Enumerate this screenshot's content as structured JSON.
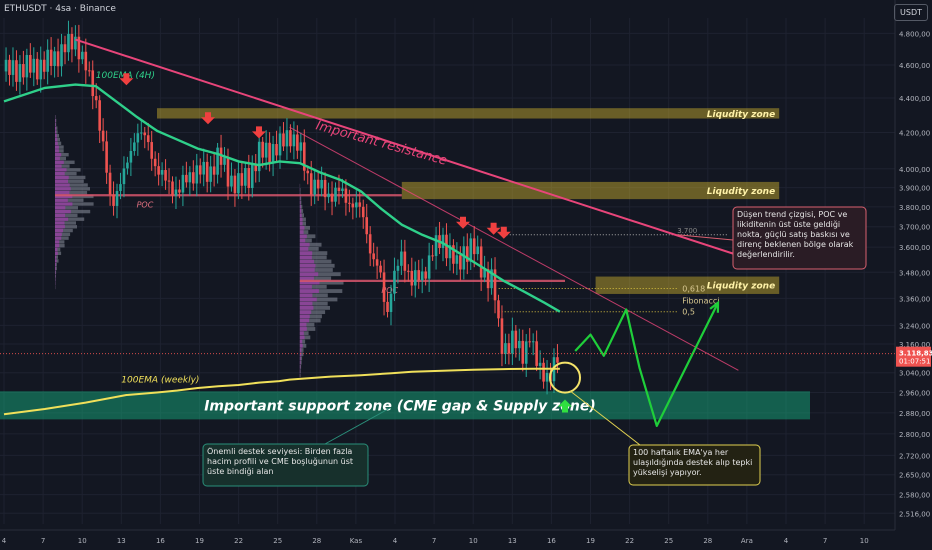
{
  "header": {
    "symbol_line": "ETHUSDT · 4sa · Binance",
    "currency": "USDT"
  },
  "colors": {
    "background": "#131722",
    "bull_candle": "#26a69a",
    "bear_candle": "#ef5350",
    "ema_4h": "#2fd08a",
    "ema_weekly": "#f0e05a",
    "resistance": "#e8457a",
    "liquidity": "#e0c030",
    "support": "#15a87a",
    "forecast": "#1fcf3a"
  },
  "chart_data": {
    "type": "candlestick",
    "x_axis": {
      "labels": [
        "4",
        "7",
        "10",
        "13",
        "16",
        "19",
        "22",
        "25",
        "28",
        "Kas",
        "4",
        "7",
        "10",
        "13",
        "16",
        "19",
        "22",
        "25",
        "28",
        "Ara",
        "4",
        "7",
        "10"
      ]
    },
    "y_axis": {
      "scale": "log",
      "ylim": [
        2480,
        4900
      ],
      "ticks": [
        "4.800,00",
        "4.600,00",
        "4.400,00",
        "4.200,00",
        "4.000,00",
        "3.900,00",
        "3.800,00",
        "3.700,00",
        "3.600,00",
        "3.480,00",
        "3.360,00",
        "3.240,00",
        "3.160,00",
        "3.040,00",
        "2.960,00",
        "2.880,00",
        "2.800,00",
        "2.720,00",
        "2.650,00",
        "2.580,00",
        "2.516,00"
      ]
    },
    "price_label": {
      "value": "3.118,83",
      "countdown": "01:07:51",
      "price": 3118.83
    },
    "price_path": [
      [
        0,
        4560
      ],
      [
        4,
        4600
      ],
      [
        7,
        4760
      ],
      [
        8,
        4580
      ],
      [
        9,
        4400
      ],
      [
        10,
        4000
      ],
      [
        10.5,
        3800
      ],
      [
        11,
        3880
      ],
      [
        12,
        4000
      ],
      [
        13,
        4220
      ],
      [
        14,
        4150
      ],
      [
        15,
        4000
      ],
      [
        16,
        3920
      ],
      [
        17,
        3880
      ],
      [
        18,
        3950
      ],
      [
        19,
        4000
      ],
      [
        20,
        3960
      ],
      [
        21,
        4080
      ],
      [
        22,
        3950
      ],
      [
        23,
        3920
      ],
      [
        24,
        3960
      ],
      [
        25,
        4080
      ],
      [
        26,
        4100
      ],
      [
        27,
        4120
      ],
      [
        28,
        4200
      ],
      [
        29,
        4100
      ],
      [
        30,
        3920
      ],
      [
        31,
        3900
      ],
      [
        32,
        3860
      ],
      [
        33,
        3880
      ],
      [
        34,
        3820
      ],
      [
        35,
        3780
      ],
      [
        35.5,
        3700
      ],
      [
        36,
        3560
      ],
      [
        37,
        3450
      ],
      [
        37.5,
        3280
      ],
      [
        38,
        3420
      ],
      [
        39,
        3560
      ],
      [
        40,
        3440
      ],
      [
        41,
        3460
      ],
      [
        42,
        3580
      ],
      [
        43,
        3640
      ],
      [
        44,
        3550
      ],
      [
        44.5,
        3490
      ],
      [
        45,
        3580
      ],
      [
        46,
        3600
      ],
      [
        47,
        3480
      ],
      [
        48,
        3430
      ],
      [
        48.5,
        3220
      ],
      [
        49,
        3140
      ],
      [
        50,
        3170
      ],
      [
        51,
        3120
      ],
      [
        51.5,
        3200
      ],
      [
        52,
        3100
      ],
      [
        53,
        3040
      ],
      [
        53.5,
        3000
      ],
      [
        54,
        3080
      ],
      [
        54.5,
        3118.83
      ]
    ],
    "ema_4h": [
      [
        0,
        4380
      ],
      [
        4,
        4460
      ],
      [
        7,
        4480
      ],
      [
        9,
        4470
      ],
      [
        11,
        4380
      ],
      [
        13,
        4290
      ],
      [
        15,
        4210
      ],
      [
        17,
        4160
      ],
      [
        19,
        4110
      ],
      [
        21,
        4080
      ],
      [
        23,
        4040
      ],
      [
        25,
        4020
      ],
      [
        27,
        4040
      ],
      [
        29,
        4030
      ],
      [
        31,
        3980
      ],
      [
        33,
        3940
      ],
      [
        35,
        3880
      ],
      [
        37,
        3790
      ],
      [
        39,
        3710
      ],
      [
        41,
        3660
      ],
      [
        43,
        3620
      ],
      [
        45,
        3560
      ],
      [
        47,
        3500
      ],
      [
        49,
        3440
      ],
      [
        51,
        3390
      ],
      [
        53,
        3340
      ],
      [
        54.5,
        3300
      ]
    ],
    "ema_weekly": [
      [
        0,
        2875
      ],
      [
        4,
        2895
      ],
      [
        8,
        2920
      ],
      [
        12,
        2950
      ],
      [
        15,
        2960
      ],
      [
        17,
        2968
      ],
      [
        19,
        2978
      ],
      [
        21,
        2985
      ],
      [
        23,
        2990
      ],
      [
        25,
        3000
      ],
      [
        27,
        3006
      ],
      [
        28,
        3012
      ],
      [
        30,
        3018
      ],
      [
        32,
        3024
      ],
      [
        35,
        3030
      ],
      [
        38,
        3038
      ],
      [
        40,
        3044
      ],
      [
        43,
        3048
      ],
      [
        46,
        3052
      ],
      [
        49,
        3055
      ],
      [
        52,
        3056
      ],
      [
        54.5,
        3056
      ]
    ],
    "resistance_line": {
      "label": "Important resistance",
      "points": [
        [
          7,
          4760
        ],
        [
          72,
          3560
        ]
      ]
    },
    "secondary_resistance_line": {
      "points": [
        [
          28,
          4230
        ],
        [
          72,
          3050
        ]
      ]
    },
    "liquidity_zones": [
      {
        "label": "Liqudity zone",
        "x_range": [
          15,
          76
        ],
        "y_range": [
          4280,
          4340
        ]
      },
      {
        "label": "Liqudity zone",
        "x_range": [
          39,
          76
        ],
        "y_range": [
          3840,
          3930
        ]
      },
      {
        "label": "Liqudity zone",
        "x_range": [
          58,
          76
        ],
        "y_range": [
          3380,
          3460
        ]
      }
    ],
    "poc_lines": [
      {
        "label": "POC",
        "x_range": [
          5,
          39
        ],
        "y": 3860
      },
      {
        "label": "POC",
        "x_range": [
          29,
          55
        ],
        "y": 3440
      }
    ],
    "support_zone": {
      "label": "Important support zone (CME gap & Supply zone)",
      "y_range": [
        2855,
        2965
      ]
    },
    "fibonacci": [
      {
        "label": "0,618",
        "y": 3405
      },
      {
        "label": "Fibonacci",
        "y": 3350
      },
      {
        "label": "0,5",
        "y": 3300
      }
    ],
    "reference_level": {
      "label": "3.700",
      "y": 3660
    },
    "red_arrows": [
      [
        12,
        4500
      ],
      [
        20,
        4270
      ],
      [
        25,
        4190
      ],
      [
        45,
        3710
      ],
      [
        48,
        3680
      ],
      [
        49,
        3660
      ]
    ],
    "green_arrow": [
      55,
      2905
    ],
    "highlight_circle": [
      55,
      3020
    ],
    "forecast_paths": [
      [
        [
          56,
          3130
        ],
        [
          57.5,
          3200
        ],
        [
          58.8,
          3110
        ],
        [
          61,
          3310
        ],
        [
          62.3,
          3060
        ],
        [
          64,
          2830
        ],
        [
          70,
          3340
        ]
      ]
    ],
    "annotations": {
      "ema_4h_label": "100EMA (4H)",
      "ema_weekly_label": "100EMA (weekly)",
      "resistance_note": "Düşen trend çizgisi, POC ve likiditenin üst üste geldiği nokta, güçlü satış baskısı ve direnç beklenen bölge olarak değerlendirilir.",
      "support_note": "Önemli destek seviyesi: Birden fazla hacim profili ve CME boşluğunun üst üste bindiği alan",
      "ema_note": "100 haftalık EMA'ya her ulaşıldığında destek alıp tepki yükselişi yapıyor."
    }
  }
}
